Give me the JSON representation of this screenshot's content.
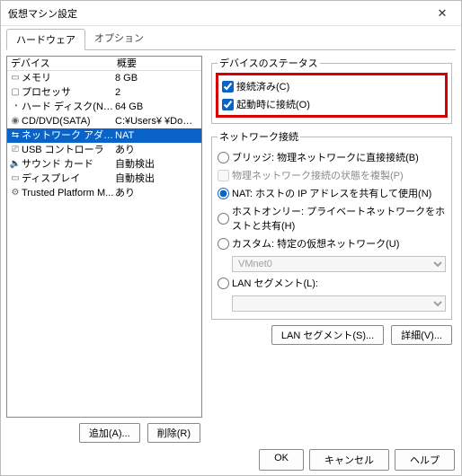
{
  "title": "仮想マシン設定",
  "tabs": {
    "hardware": "ハードウェア",
    "options": "オプション"
  },
  "left": {
    "header": {
      "device": "デバイス",
      "summary": "概要"
    },
    "rows": [
      {
        "icon": "▭",
        "device": "メモリ",
        "summary": "8 GB"
      },
      {
        "icon": "▢",
        "device": "プロセッサ",
        "summary": "2"
      },
      {
        "icon": "◔",
        "device": "ハード ディスク(NVMe)",
        "summary": "64 GB"
      },
      {
        "icon": "◉",
        "device": "CD/DVD(SATA)",
        "summary": "C:¥Users¥       ¥Downloads¥..."
      },
      {
        "icon": "⇆",
        "device": "ネットワーク アダプタ",
        "summary": "NAT"
      },
      {
        "icon": "⎚",
        "device": "USB コントローラ",
        "summary": "あり"
      },
      {
        "icon": "🔈",
        "device": "サウンド カード",
        "summary": "自動検出"
      },
      {
        "icon": "▭",
        "device": "ディスプレイ",
        "summary": "自動検出"
      },
      {
        "icon": "⚙",
        "device": "Trusted Platform M...",
        "summary": "あり"
      }
    ],
    "selected_index": 4,
    "add_btn": "追加(A)...",
    "remove_btn": "削除(R)"
  },
  "right": {
    "status": {
      "legend": "デバイスのステータス",
      "connected": "接続済み(C)",
      "connect_on_boot": "起動時に接続(O)"
    },
    "network": {
      "legend": "ネットワーク接続",
      "bridge": "ブリッジ: 物理ネットワークに直接接続(B)",
      "bridge_sub": "物理ネットワーク接続の状態を複製(P)",
      "nat": "NAT: ホストの IP アドレスを共有して使用(N)",
      "hostonly": "ホストオンリー: プライベートネットワークをホストと共有(H)",
      "custom": "カスタム: 特定の仮想ネットワーク(U)",
      "custom_select": "VMnet0",
      "lanseg": "LAN セグメント(L):",
      "lanseg_select": ""
    },
    "lan_btn": "LAN セグメント(S)...",
    "adv_btn": "詳細(V)..."
  },
  "footer": {
    "ok": "OK",
    "cancel": "キャンセル",
    "help": "ヘルプ"
  }
}
